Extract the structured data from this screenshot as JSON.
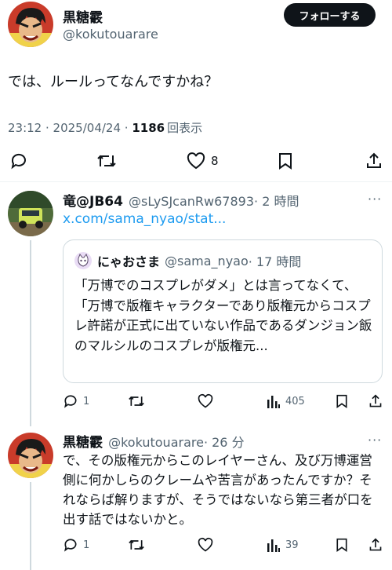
{
  "main_tweet": {
    "author_name": "黒糖霰",
    "author_handle": "@kokutouarare",
    "follow_label": "フォローする",
    "text": "では、ルールってなんですかね？",
    "time": "23:12",
    "sep": " · ",
    "date": "2025/04/24",
    "views_count": "1186",
    "views_label": "回表示",
    "likes": "8"
  },
  "reply1": {
    "author_name": "竜@JB64",
    "author_handle": "@sLySJcanRw67893",
    "time": "· 2 時間",
    "link": "x.com/sama_nyao/stat...",
    "quote": {
      "author_name": "にゃおさま",
      "author_handle": "@sama_nyao",
      "time": "· 17 時間",
      "text": "「万博でのコスプレがダメ」とは言ってなくて、\n「万博で版権キャラクターであり版権元からコスプレ許諾が正式に出ていない作品であるダンジョン飯のマルシルのコスプレが版権元..."
    },
    "replies": "1",
    "views": "405"
  },
  "reply2": {
    "author_name": "黒糖霰",
    "author_handle": "@kokutouarare",
    "time": "· 26 分",
    "text": "で、その版権元からこのレイヤーさん、及び万博運営側に何かしらのクレームや苦言があったんですか？それならば解りますが、そうではないなら第三者が口を出す話ではないかと。",
    "replies": "1",
    "views": "39"
  },
  "colors": {
    "accent": "#1d9bf0",
    "text": "#0f1419",
    "secondary": "#536471"
  }
}
